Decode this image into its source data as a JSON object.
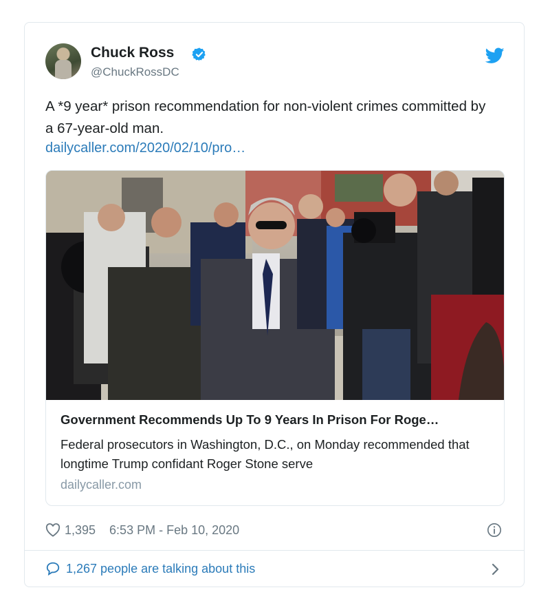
{
  "tweet": {
    "author_name": "Chuck Ross",
    "author_handle": "@ChuckRossDC",
    "text": "A *9 year* prison recommendation for non-violent crimes committed by a 67-year-old man.",
    "link_text": "dailycaller.com/2020/02/10/pro…",
    "likes": "1,395",
    "timestamp": "6:53 PM - Feb 10, 2020",
    "talking": "1,267 people are talking about this"
  },
  "card": {
    "title": "Government Recommends Up To 9 Years In Prison For Roge…",
    "description": "Federal prosecutors in Washington, D.C., on Monday recommended that longtime Trump confidant Roger Stone serve",
    "domain": "dailycaller.com"
  },
  "icons": {
    "verified": "verified-badge-icon",
    "platform": "twitter-bird-icon",
    "like": "heart-icon",
    "info": "info-icon",
    "reply": "speech-bubble-icon",
    "more": "chevron-right-icon"
  },
  "colors": {
    "link": "#2b7bb9",
    "verified": "#1da1f2",
    "muted": "#697882",
    "border": "#e1e8ed"
  }
}
